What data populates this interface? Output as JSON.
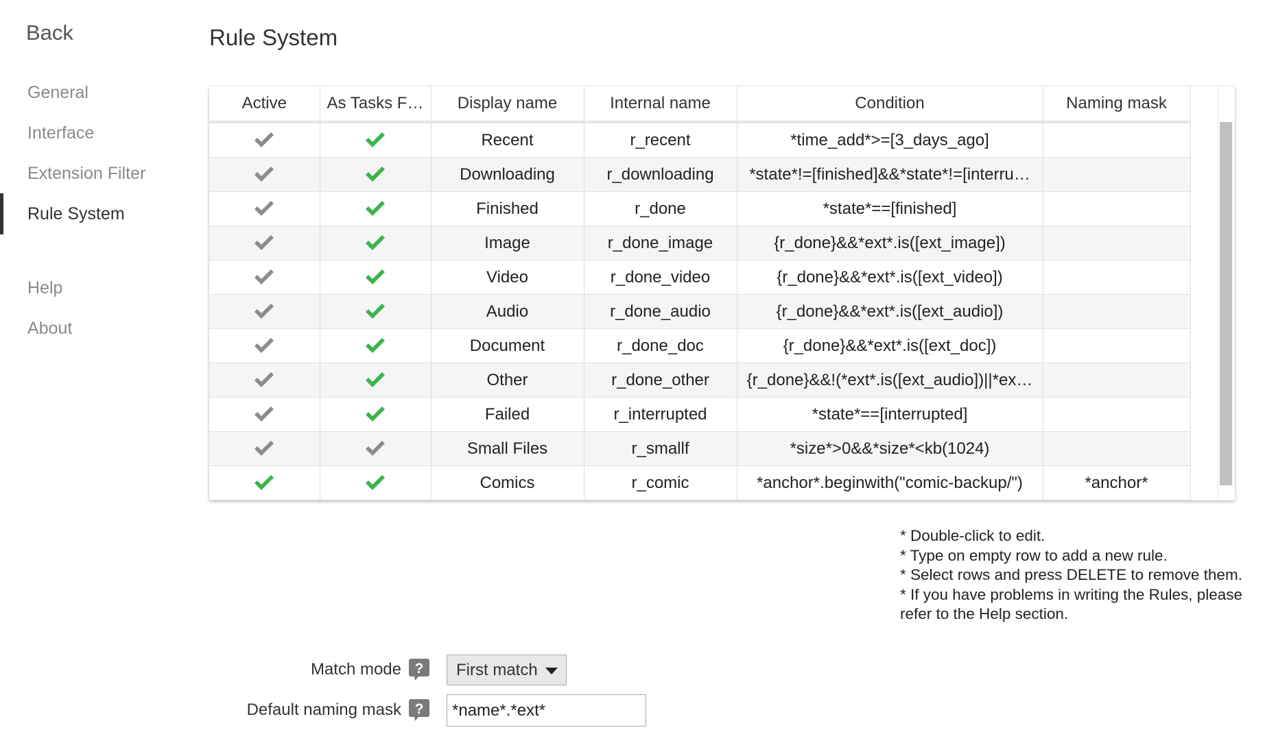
{
  "sidebar": {
    "back_label": "Back",
    "items": [
      {
        "label": "General"
      },
      {
        "label": "Interface"
      },
      {
        "label": "Extension Filter"
      },
      {
        "label": "Rule System"
      },
      {
        "label": "Help"
      },
      {
        "label": "About"
      }
    ],
    "active_item": "Rule System"
  },
  "page": {
    "title": "Rule System"
  },
  "table": {
    "columns": [
      "Active",
      "As Tasks F…",
      "Display name",
      "Internal name",
      "Condition",
      "Naming mask"
    ],
    "rows": [
      {
        "active": false,
        "as_tasks": true,
        "display_name": "Recent",
        "internal_name": "r_recent",
        "condition": "*time_add*>=[3_days_ago]",
        "naming_mask": ""
      },
      {
        "active": false,
        "as_tasks": true,
        "display_name": "Downloading",
        "internal_name": "r_downloading",
        "condition": "*state*!=[finished]&&*state*!=[interru…",
        "naming_mask": ""
      },
      {
        "active": false,
        "as_tasks": true,
        "display_name": "Finished",
        "internal_name": "r_done",
        "condition": "*state*==[finished]",
        "naming_mask": ""
      },
      {
        "active": false,
        "as_tasks": true,
        "display_name": "Image",
        "internal_name": "r_done_image",
        "condition": "{r_done}&&*ext*.is([ext_image])",
        "naming_mask": ""
      },
      {
        "active": false,
        "as_tasks": true,
        "display_name": "Video",
        "internal_name": "r_done_video",
        "condition": "{r_done}&&*ext*.is([ext_video])",
        "naming_mask": ""
      },
      {
        "active": false,
        "as_tasks": true,
        "display_name": "Audio",
        "internal_name": "r_done_audio",
        "condition": "{r_done}&&*ext*.is([ext_audio])",
        "naming_mask": ""
      },
      {
        "active": false,
        "as_tasks": true,
        "display_name": "Document",
        "internal_name": "r_done_doc",
        "condition": "{r_done}&&*ext*.is([ext_doc])",
        "naming_mask": ""
      },
      {
        "active": false,
        "as_tasks": true,
        "display_name": "Other",
        "internal_name": "r_done_other",
        "condition": "{r_done}&&!(*ext*.is([ext_audio])||*ex…",
        "naming_mask": ""
      },
      {
        "active": false,
        "as_tasks": true,
        "display_name": "Failed",
        "internal_name": "r_interrupted",
        "condition": "*state*==[interrupted]",
        "naming_mask": ""
      },
      {
        "active": false,
        "as_tasks": false,
        "display_name": "Small Files",
        "internal_name": "r_smallf",
        "condition": "*size*>0&&*size*<kb(1024)",
        "naming_mask": ""
      },
      {
        "active": true,
        "as_tasks": true,
        "display_name": "Comics",
        "internal_name": "r_comic",
        "condition": "*anchor*.beginwith(\"comic-backup/\")",
        "naming_mask": "*anchor*"
      }
    ]
  },
  "notes": [
    "* Double-click to edit.",
    "* Type on empty row to add a new rule.",
    "* Select rows and press DELETE to remove them.",
    "* If you have problems in writing the Rules, please refer to the Help section."
  ],
  "form": {
    "match_mode_label": "Match mode",
    "match_mode_value": "First match",
    "default_mask_label": "Default naming mask",
    "default_mask_value": "*name*.*ext*"
  },
  "icons": {
    "check_on": "check-icon-green",
    "check_off": "check-icon-gray",
    "help": "help-icon",
    "dropdown": "chevron-down-icon"
  },
  "colors": {
    "check_on": "#3cb44b",
    "check_off": "#8c8c8c",
    "alt_row": "#f5f5f5"
  }
}
